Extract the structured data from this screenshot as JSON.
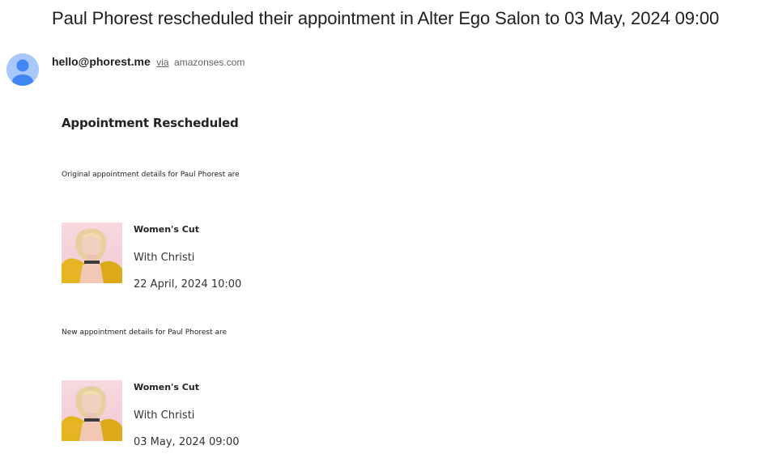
{
  "email": {
    "subject": "Paul Phorest rescheduled their appointment in Alter Ego Salon  to 03 May, 2024 09:00",
    "sender": {
      "address": "hello@phorest.me",
      "via_label": "via",
      "via_domain": "amazonses.com",
      "avatar_icon": "person-icon"
    }
  },
  "body": {
    "title": "Appointment Rescheduled",
    "original_label": "Original appointment details for Paul Phorest are",
    "new_label": "New appointment details for Paul Phorest are",
    "original_appointment": {
      "service": "Women's Cut",
      "staff": "With Christi",
      "datetime": "22 April, 2024 10:00",
      "photo_icon": "staff-photo"
    },
    "new_appointment": {
      "service": "Women's Cut",
      "staff": "With Christi",
      "datetime": "03 May, 2024 09:00",
      "photo_icon": "staff-photo"
    }
  },
  "colors": {
    "avatar_bg": "#a8c7fa",
    "avatar_fg": "#4285f4"
  }
}
